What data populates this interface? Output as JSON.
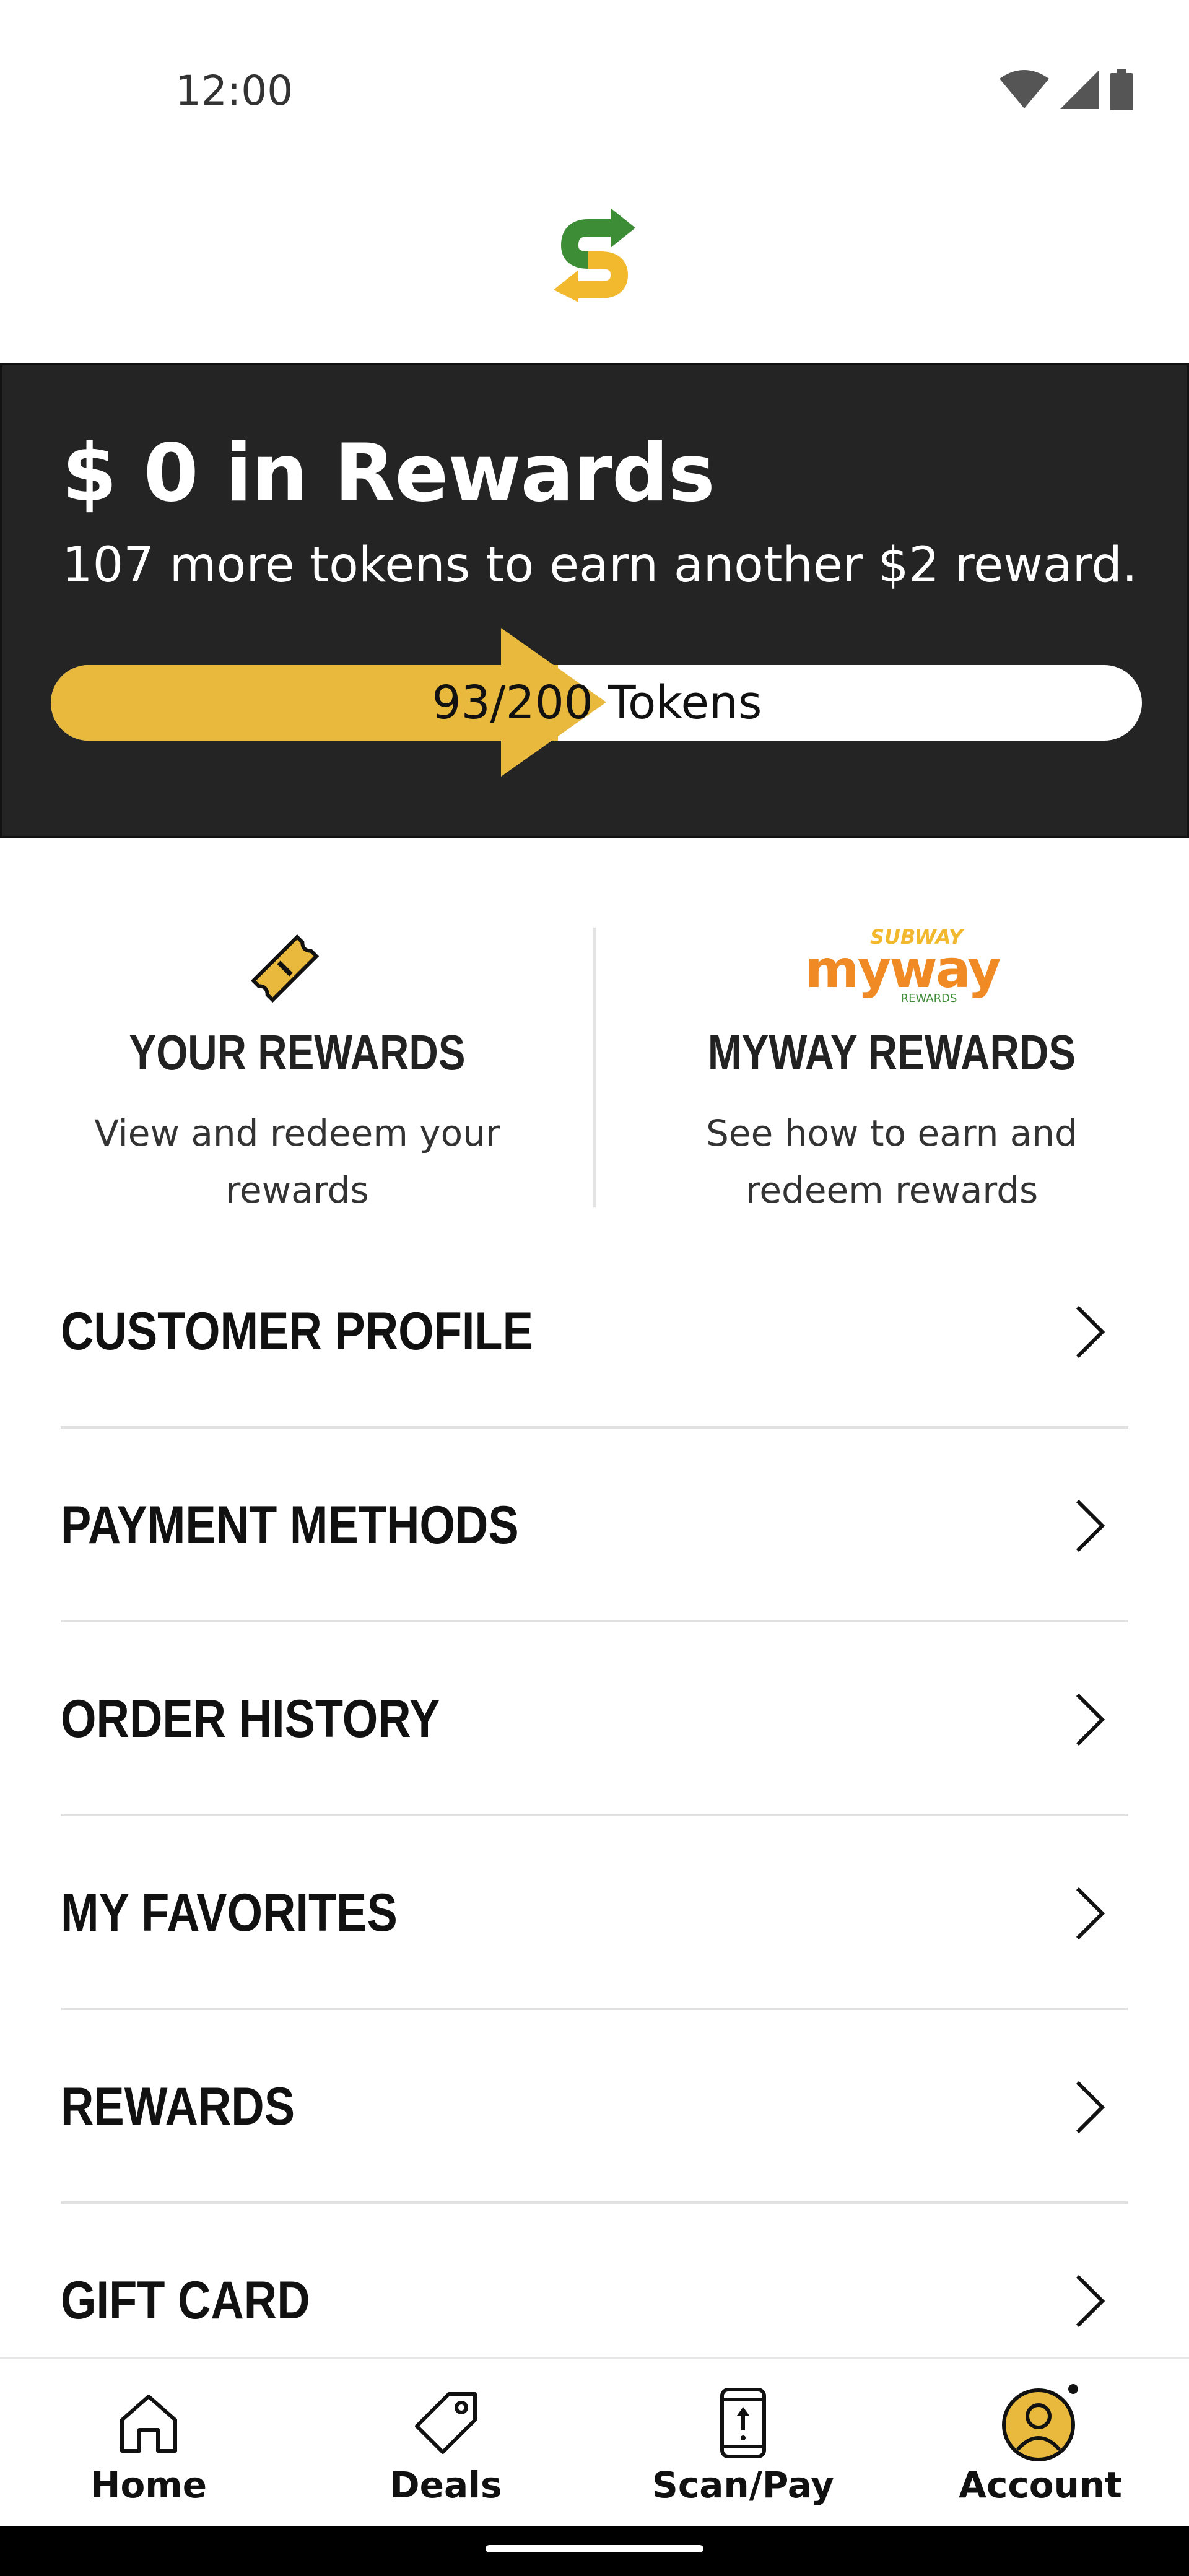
{
  "status_bar": {
    "time": "12:00"
  },
  "rewards": {
    "title": "$ 0 in Rewards",
    "subtitle": "107 more tokens to earn another $2 reward.",
    "progress_label": "93/200 Tokens",
    "progress_fraction": 0.465,
    "accent_color": "#e8b93c",
    "banner_color": "#242424"
  },
  "tiles": {
    "your_rewards": {
      "title": "YOUR REWARDS",
      "description": "View and redeem your rewards"
    },
    "myway_rewards": {
      "title": "MYWAY REWARDS",
      "description": "See how to earn and redeem rewards",
      "logo_text": {
        "top": "SUBWAY",
        "main": "myway",
        "bottom": "REWARDS"
      }
    }
  },
  "menu": {
    "items": [
      {
        "label": "CUSTOMER PROFILE"
      },
      {
        "label": "PAYMENT METHODS"
      },
      {
        "label": "ORDER HISTORY"
      },
      {
        "label": "MY FAVORITES"
      },
      {
        "label": "REWARDS"
      },
      {
        "label": "GIFT CARD"
      }
    ]
  },
  "nav": {
    "items": [
      {
        "label": "Home",
        "icon": "home-icon"
      },
      {
        "label": "Deals",
        "icon": "tag-icon"
      },
      {
        "label": "Scan/Pay",
        "icon": "phone-scan-icon"
      },
      {
        "label": "Account",
        "icon": "account-icon",
        "active": true
      }
    ]
  },
  "colors": {
    "brand_green": "#3d8d36",
    "brand_yellow": "#f2b82e",
    "myway_orange": "#f08a24"
  }
}
